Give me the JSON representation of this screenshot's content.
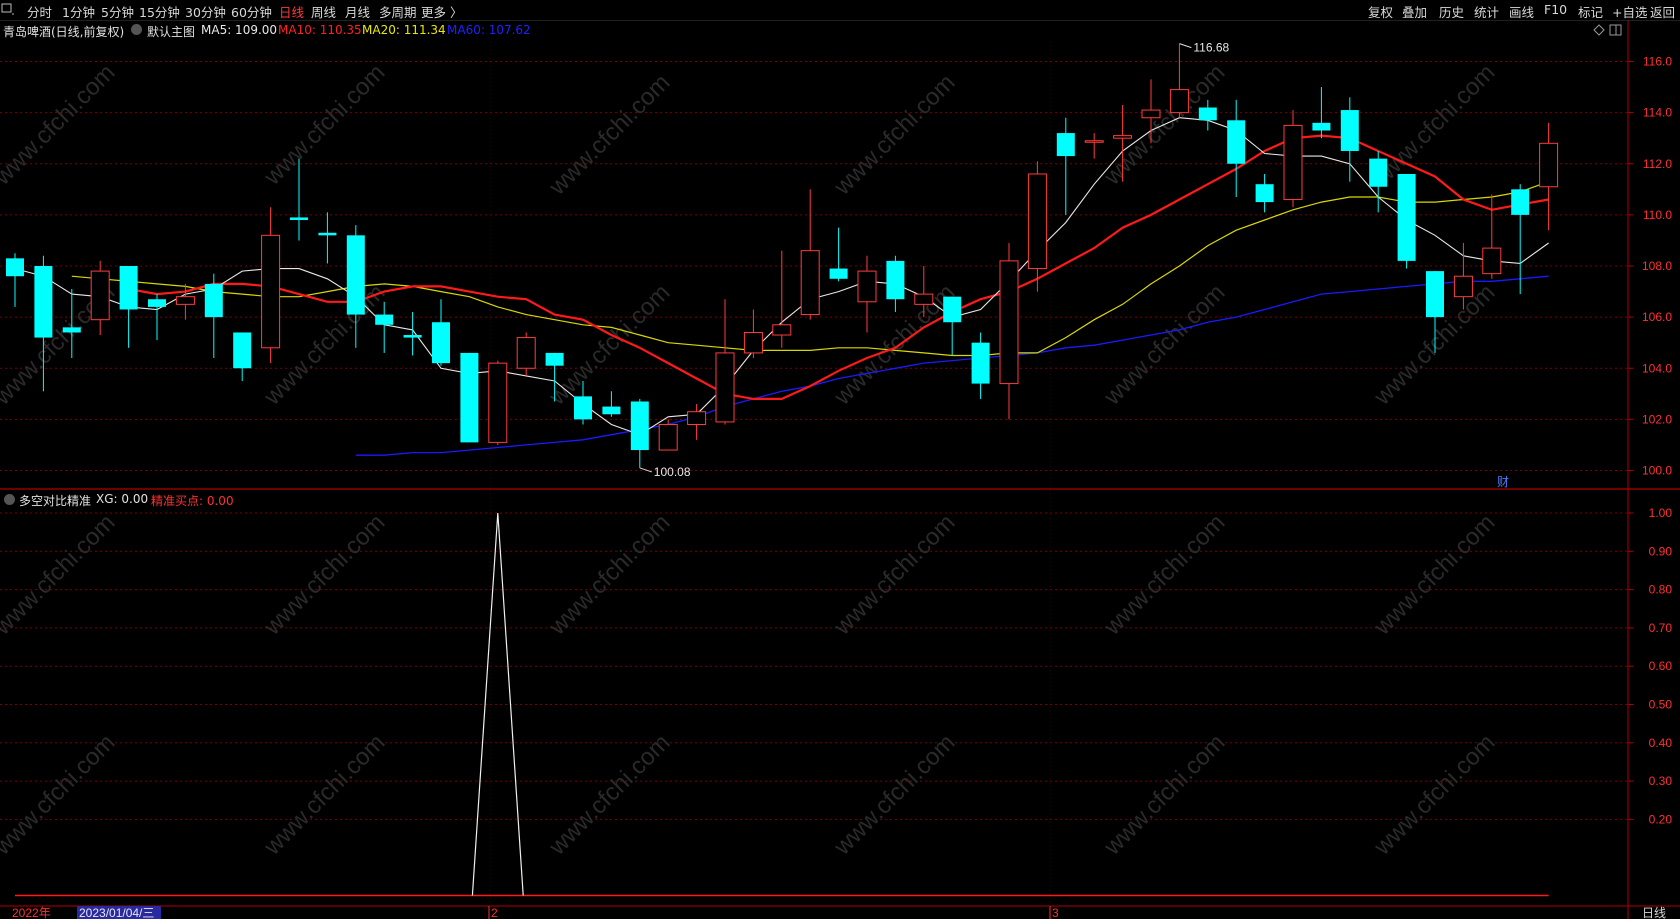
{
  "toolbar": {
    "periods": [
      "分时",
      "1分钟",
      "5分钟",
      "15分钟",
      "30分钟",
      "60分钟",
      "日线",
      "周线",
      "月线",
      "多周期",
      "更多 〉"
    ],
    "active_period": "日线",
    "actions": [
      "复权",
      "叠加",
      "历史",
      "统计",
      "画线",
      "F10",
      "标记",
      "+自选",
      "返回"
    ],
    "sys_icon": "window-menu-icon"
  },
  "main_panel": {
    "stock_name": "青岛啤酒(日线,前复权)",
    "template_label": "默认主图",
    "ma_labels": [
      {
        "text": "MA5: 109.00",
        "color": "#e8e8e8"
      },
      {
        "text": "MA10: 110.35",
        "color": "#ff2020"
      },
      {
        "text": "MA20: 111.34",
        "color": "#e8e800"
      },
      {
        "text": "MA60: 107.62",
        "color": "#2020ff"
      }
    ],
    "y_ticks": [
      "116.0",
      "114.0",
      "112.0",
      "110.0",
      "108.0",
      "106.0",
      "104.0",
      "102.0",
      "100.0"
    ],
    "high_label": "116.68",
    "low_label": "100.08",
    "finance_marker": "财",
    "icons": [
      "diamond-icon",
      "window-icon"
    ]
  },
  "indicator_panel": {
    "name": "多空对比精准",
    "xg_label": "XG: 0.00",
    "buy_label": "精准买点: 0.00",
    "y_ticks": [
      "1.00",
      "0.90",
      "0.80",
      "0.70",
      "0.60",
      "0.50",
      "0.40",
      "0.30",
      "0.20"
    ]
  },
  "time_axis": {
    "year_label": "2022年",
    "cursor_date": "2023/01/04/三",
    "month_labels": [
      "2",
      "3"
    ],
    "period_label": "日线"
  },
  "watermark": "www.cfchi.com",
  "chart_data": {
    "type": "candlestick",
    "ylim": [
      99.6,
      116.9
    ],
    "candles": [
      {
        "o": 108.3,
        "h": 108.5,
        "l": 106.4,
        "c": 107.6
      },
      {
        "o": 108.0,
        "h": 108.4,
        "l": 103.1,
        "c": 105.2
      },
      {
        "o": 105.6,
        "h": 107.1,
        "l": 104.4,
        "c": 105.4
      },
      {
        "o": 105.9,
        "h": 108.2,
        "l": 105.3,
        "c": 107.8
      },
      {
        "o": 108.0,
        "h": 108.0,
        "l": 104.8,
        "c": 106.3
      },
      {
        "o": 106.7,
        "h": 106.9,
        "l": 105.1,
        "c": 106.4
      },
      {
        "o": 106.5,
        "h": 107.3,
        "l": 105.9,
        "c": 106.8
      },
      {
        "o": 107.3,
        "h": 107.7,
        "l": 104.4,
        "c": 106.0
      },
      {
        "o": 105.4,
        "h": 105.4,
        "l": 103.5,
        "c": 104.0
      },
      {
        "o": 104.8,
        "h": 110.3,
        "l": 104.2,
        "c": 109.2
      },
      {
        "o": 109.9,
        "h": 112.2,
        "l": 109.0,
        "c": 109.8
      },
      {
        "o": 109.3,
        "h": 110.1,
        "l": 108.1,
        "c": 109.2
      },
      {
        "o": 109.2,
        "h": 109.6,
        "l": 104.8,
        "c": 106.1
      },
      {
        "o": 106.1,
        "h": 106.6,
        "l": 104.6,
        "c": 105.7
      },
      {
        "o": 105.3,
        "h": 106.2,
        "l": 104.5,
        "c": 105.2
      },
      {
        "o": 105.8,
        "h": 106.7,
        "l": 104.1,
        "c": 104.2
      },
      {
        "o": 104.6,
        "h": 104.6,
        "l": 101.1,
        "c": 101.1
      },
      {
        "o": 101.1,
        "h": 104.3,
        "l": 101.0,
        "c": 104.2
      },
      {
        "o": 104.0,
        "h": 105.4,
        "l": 103.7,
        "c": 105.2
      },
      {
        "o": 104.6,
        "h": 104.6,
        "l": 102.7,
        "c": 104.1
      },
      {
        "o": 102.9,
        "h": 103.5,
        "l": 101.8,
        "c": 102.0
      },
      {
        "o": 102.5,
        "h": 103.1,
        "l": 102.1,
        "c": 102.2
      },
      {
        "o": 102.7,
        "h": 102.8,
        "l": 100.1,
        "c": 100.8
      },
      {
        "o": 100.8,
        "h": 102.0,
        "l": 100.8,
        "c": 101.8
      },
      {
        "o": 101.8,
        "h": 102.6,
        "l": 101.2,
        "c": 102.3
      },
      {
        "o": 101.9,
        "h": 106.7,
        "l": 101.8,
        "c": 104.6
      },
      {
        "o": 104.6,
        "h": 106.3,
        "l": 104.4,
        "c": 105.4
      },
      {
        "o": 105.3,
        "h": 108.6,
        "l": 104.8,
        "c": 105.7
      },
      {
        "o": 106.1,
        "h": 111.0,
        "l": 105.9,
        "c": 108.6
      },
      {
        "o": 107.9,
        "h": 109.5,
        "l": 107.4,
        "c": 107.5
      },
      {
        "o": 106.6,
        "h": 108.4,
        "l": 105.4,
        "c": 107.8
      },
      {
        "o": 108.2,
        "h": 108.4,
        "l": 106.2,
        "c": 106.7
      },
      {
        "o": 106.5,
        "h": 108.0,
        "l": 106.0,
        "c": 106.9
      },
      {
        "o": 106.8,
        "h": 106.8,
        "l": 104.5,
        "c": 105.8
      },
      {
        "o": 105.0,
        "h": 105.4,
        "l": 102.8,
        "c": 103.4
      },
      {
        "o": 103.4,
        "h": 108.9,
        "l": 102.0,
        "c": 108.2
      },
      {
        "o": 107.9,
        "h": 112.1,
        "l": 107.0,
        "c": 111.6
      },
      {
        "o": 113.2,
        "h": 113.8,
        "l": 110.0,
        "c": 112.3
      },
      {
        "o": 112.9,
        "h": 113.2,
        "l": 112.2,
        "c": 112.9
      },
      {
        "o": 113.0,
        "h": 114.3,
        "l": 111.3,
        "c": 113.1
      },
      {
        "o": 113.8,
        "h": 115.3,
        "l": 112.8,
        "c": 114.1
      },
      {
        "o": 114.0,
        "h": 116.7,
        "l": 113.8,
        "c": 114.9
      },
      {
        "o": 114.2,
        "h": 114.5,
        "l": 113.3,
        "c": 113.7
      },
      {
        "o": 113.7,
        "h": 114.5,
        "l": 110.7,
        "c": 112.0
      },
      {
        "o": 111.2,
        "h": 111.6,
        "l": 110.1,
        "c": 110.5
      },
      {
        "o": 110.6,
        "h": 114.1,
        "l": 110.3,
        "c": 113.5
      },
      {
        "o": 113.6,
        "h": 115.0,
        "l": 113.0,
        "c": 113.3
      },
      {
        "o": 114.1,
        "h": 114.6,
        "l": 111.3,
        "c": 112.5
      },
      {
        "o": 112.2,
        "h": 112.5,
        "l": 110.1,
        "c": 111.1
      },
      {
        "o": 111.6,
        "h": 111.6,
        "l": 107.9,
        "c": 108.2
      },
      {
        "o": 107.8,
        "h": 107.8,
        "l": 104.6,
        "c": 106.0
      },
      {
        "o": 106.8,
        "h": 108.9,
        "l": 106.3,
        "c": 107.6
      },
      {
        "o": 107.7,
        "h": 110.8,
        "l": 107.5,
        "c": 108.7
      },
      {
        "o": 111.0,
        "h": 111.2,
        "l": 106.9,
        "c": 110.0
      },
      {
        "o": 111.1,
        "h": 113.6,
        "l": 109.4,
        "c": 112.8
      }
    ],
    "ma5": [
      107.9,
      107.6,
      106.9,
      106.8,
      106.4,
      106.3,
      106.9,
      107.1,
      107.8,
      107.9,
      107.9,
      107.5,
      106.8,
      105.7,
      105.5,
      104.0,
      103.8,
      103.9,
      103.7,
      103.5,
      102.6,
      101.8,
      101.4,
      102.1,
      102.2,
      103.3,
      104.7,
      105.8,
      106.7,
      107.0,
      107.4,
      107.3,
      106.8,
      106.0,
      106.3,
      107.4,
      108.6,
      109.7,
      111.2,
      112.5,
      113.3,
      113.8,
      113.7,
      113.3,
      112.4,
      112.3,
      112.3,
      112.0,
      110.7,
      109.8,
      109.2,
      108.4,
      108.2,
      108.1,
      108.9
    ],
    "ma10": [
      107.1,
      106.9,
      107.0,
      107.3,
      107.3,
      107.2,
      106.9,
      106.6,
      106.6,
      107.0,
      107.2,
      107.2,
      107.0,
      106.8,
      106.7,
      106.1,
      105.9,
      105.3,
      104.8,
      104.2,
      103.6,
      103.0,
      102.8,
      102.8,
      103.3,
      103.9,
      104.4,
      104.8,
      105.6,
      106.2,
      106.7,
      107.0,
      107.5,
      108.1,
      108.7,
      109.5,
      110.0,
      110.6,
      111.2,
      111.8,
      112.5,
      113.0,
      113.1,
      113.0,
      112.5,
      112.0,
      111.5,
      110.6,
      110.2,
      110.4,
      110.6
    ],
    "ma20": [
      107.6,
      107.5,
      107.4,
      107.3,
      107.2,
      107.0,
      106.9,
      106.8,
      106.8,
      107.0,
      107.2,
      107.3,
      107.2,
      107.0,
      106.8,
      106.4,
      106.1,
      105.9,
      105.7,
      105.6,
      105.3,
      105.0,
      104.9,
      104.8,
      104.7,
      104.7,
      104.7,
      104.8,
      104.8,
      104.7,
      104.6,
      104.5,
      104.5,
      104.6,
      104.6,
      105.2,
      105.9,
      106.5,
      107.3,
      108.0,
      108.8,
      109.4,
      109.8,
      110.2,
      110.5,
      110.7,
      110.7,
      110.5,
      110.5,
      110.6,
      110.7,
      110.9,
      111.3
    ],
    "ma60": [
      100.6,
      100.6,
      100.7,
      100.7,
      100.8,
      100.9,
      101.0,
      101.1,
      101.2,
      101.4,
      101.6,
      101.8,
      102.1,
      102.5,
      102.8,
      103.1,
      103.3,
      103.6,
      103.8,
      104.0,
      104.2,
      104.3,
      104.4,
      104.5,
      104.6,
      104.8,
      104.9,
      105.1,
      105.3,
      105.5,
      105.8,
      106.0,
      106.3,
      106.6,
      106.9,
      107.0,
      107.1,
      107.2,
      107.3,
      107.4,
      107.4,
      107.5,
      107.6
    ],
    "xg_spike_index": 17,
    "xg_values_shown": [
      0,
      1
    ]
  },
  "colors": {
    "up": "#ff3c3c",
    "down": "#00ffff",
    "grid": "#7a0000",
    "axis": "#b00000",
    "bg": "#000000"
  }
}
